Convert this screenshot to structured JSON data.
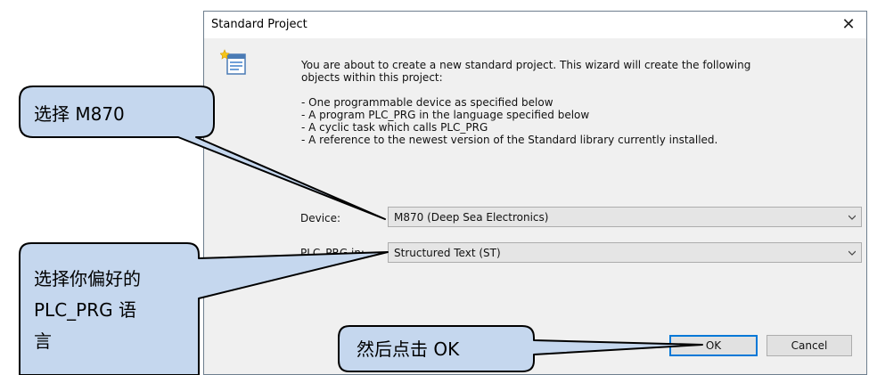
{
  "dialog": {
    "title": "Standard Project",
    "close_glyph": "✕",
    "icon": "wizard-icon",
    "description": {
      "intro_line1": "You are about to create a new standard project. This wizard will create the following",
      "intro_line2": "objects within this project:",
      "bullets": [
        "- One programmable device as specified below",
        "- A program PLC_PRG in the language specified below",
        "- A cyclic task which calls PLC_PRG",
        "- A reference to the newest version of the Standard library currently installed."
      ]
    },
    "device": {
      "label": "Device:",
      "value": "M870 (Deep Sea Electronics)"
    },
    "plc_prg": {
      "label": "PLC_PRG in:",
      "value": "Structured Text (ST)"
    },
    "buttons": {
      "ok": "OK",
      "cancel": "Cancel"
    }
  },
  "callouts": {
    "device": "选择 M870",
    "language_line1": "选择你偏好的",
    "language_line2": "PLC_PRG 语",
    "language_line3": "言",
    "ok": "然后点击 OK"
  },
  "colors": {
    "callout_fill": "#c5d7ee",
    "callout_stroke": "#000000",
    "default_button_border": "#0078d7",
    "dialog_bg": "#f0f0f0"
  }
}
